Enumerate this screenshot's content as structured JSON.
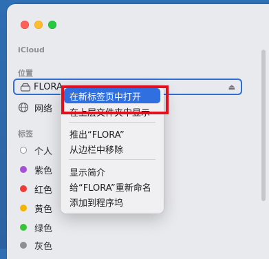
{
  "sidebar": {
    "icloud_label": "iCloud",
    "locations_label": "位置",
    "tags_label": "标签",
    "locations": [
      {
        "label": "FLORA",
        "icon": "drive-icon"
      },
      {
        "label": "网络",
        "icon": "globe-icon"
      }
    ],
    "tags": [
      {
        "label": "个人",
        "color": "#ffffff"
      },
      {
        "label": "紫色",
        "color": "#a54fd6"
      },
      {
        "label": "红色",
        "color": "#ef3a36"
      },
      {
        "label": "黄色",
        "color": "#f4b400"
      },
      {
        "label": "绿色",
        "color": "#37c43a"
      },
      {
        "label": "灰色",
        "color": "#8e8e93"
      }
    ]
  },
  "context_menu": {
    "items": [
      {
        "label": "在新标签页中打开",
        "active": true
      },
      {
        "label": "在上层文件夹中显示",
        "active": false
      },
      {
        "label": "推出“FLORA”",
        "active": false
      },
      {
        "label": "从边栏中移除",
        "active": false
      },
      {
        "label": "显示简介",
        "active": false
      },
      {
        "label": "给“FLORA”重新命名",
        "active": false
      },
      {
        "label": "添加到程序坞",
        "active": false
      }
    ]
  },
  "colors": {
    "accent": "#2f6fe0",
    "highlight": "#e0101e"
  }
}
